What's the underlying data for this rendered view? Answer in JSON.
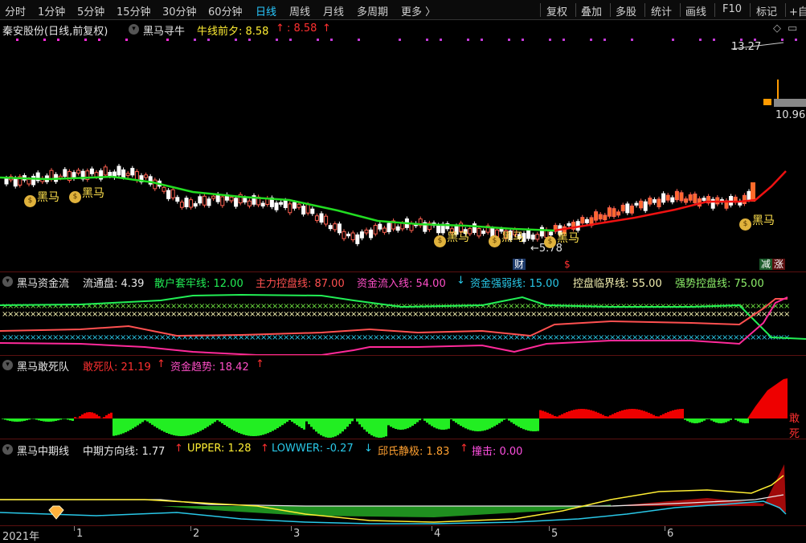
{
  "toolbar": {
    "timeframes": [
      "分时",
      "1分钟",
      "5分钟",
      "15分钟",
      "30分钟",
      "60分钟",
      "日线",
      "周线",
      "月线",
      "多周期",
      "更多 〉"
    ],
    "active_timeframe": "日线",
    "tools": [
      "复权",
      "叠加",
      "多股",
      "统计",
      "画线",
      "F10",
      "标记",
      "+自"
    ]
  },
  "main_panel": {
    "stock_title": "秦安股份(日线,前复权)",
    "indicator_name": "黑马寻牛",
    "line_label": "牛线前夕: 8.58",
    "line_value_text": ": 8.58",
    "line_arrow": "↑",
    "price_high": "13.27",
    "price_mid": "10.96",
    "price_low_arrow": "←5.78",
    "signal_label": "黑马",
    "marker_cai": "财",
    "marker_s": "$",
    "marker_jian": "减",
    "marker_zhang": "涨",
    "colors": {
      "up": "#ff6060",
      "down": "#ffffff",
      "ma_green": "#22dd22",
      "ma_red": "#ee1111"
    }
  },
  "fund_panel": {
    "name": "黑马资金流",
    "items": [
      {
        "label": "流通盘: 4.39",
        "color": "#e8e8e8"
      },
      {
        "label": "散户套牢线: 12.00",
        "color": "#22ee55"
      },
      {
        "label": "主力控盘线: 87.00",
        "color": "#ff5050"
      },
      {
        "label": "资金流入线: 54.00",
        "color": "#ff4fc8"
      },
      {
        "label": "资金强弱线: 15.00",
        "color": "#29c8e8"
      },
      {
        "label": "控盘临界线: 55.00",
        "color": "#f4f0b0"
      },
      {
        "label": "强势控盘线: 75.00",
        "color": "#8ef06a"
      }
    ],
    "arrow_down": "↓"
  },
  "dare_panel": {
    "name": "黑马敢死队",
    "items": [
      {
        "label": "敢死队: 21.19",
        "color": "#ff3030"
      },
      {
        "label": "资金趋势: 18.42",
        "color": "#ff4fc8"
      }
    ],
    "arrow_up": "↑",
    "right_label": "敢死"
  },
  "mid_panel": {
    "name": "黑马中期线",
    "items": [
      {
        "label": "中期方向线: 1.77",
        "color": "#e8e8e8"
      },
      {
        "label": "UPPER: 1.28",
        "color": "#ffee33"
      },
      {
        "label": "LOWWER: -0.27",
        "color": "#29c8e8"
      },
      {
        "label": "邱氏静极: 1.83",
        "color": "#ffa030"
      },
      {
        "label": "撞击: 0.00",
        "color": "#ff4fe0"
      }
    ],
    "arrows": [
      "↑",
      "↑",
      "↓",
      "↑"
    ]
  },
  "axis": {
    "labels": [
      "2021年",
      "1",
      "2",
      "3",
      "4",
      "5",
      "6"
    ]
  }
}
